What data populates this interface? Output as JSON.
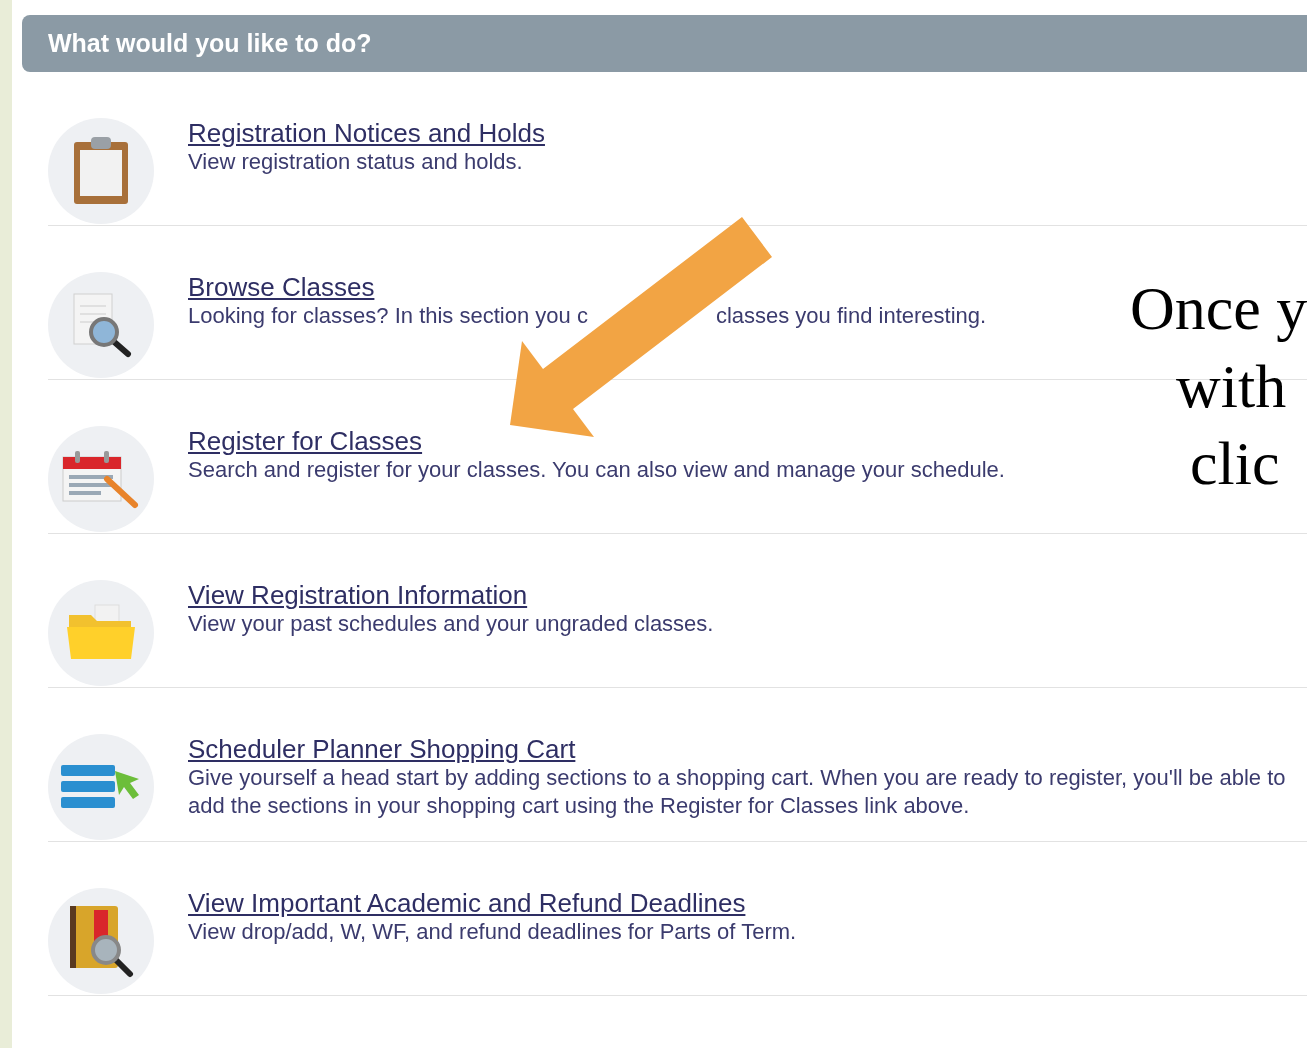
{
  "header": {
    "title": "What would you like to do?"
  },
  "items": [
    {
      "title": "Registration Notices and Holds",
      "description_lines": [
        "View registration status and holds."
      ]
    },
    {
      "title": "Browse Classes",
      "description_parts": [
        "Looking for classes? In this section you c",
        "classes you find interesting."
      ]
    },
    {
      "title": "Register for Classes",
      "description_lines": [
        "Search and register for your classes. You can also view and manage your schedule."
      ]
    },
    {
      "title": "View Registration Information",
      "description_lines": [
        "View your past schedules and your ungraded classes."
      ]
    },
    {
      "title": "Scheduler Planner Shopping Cart",
      "description_lines": [
        "Give yourself a head start by adding sections to a shopping cart. When you are ready to register, you'll be able to",
        "add the sections in your shopping cart using the Register for Classes link above."
      ]
    },
    {
      "title": "View Important Academic and Refund Deadlines",
      "description_lines": [
        "View drop/add, W, WF, and refund deadlines for Parts of Term."
      ]
    }
  ],
  "slide_text_lines": [
    "Once y",
    "with",
    "clic"
  ]
}
